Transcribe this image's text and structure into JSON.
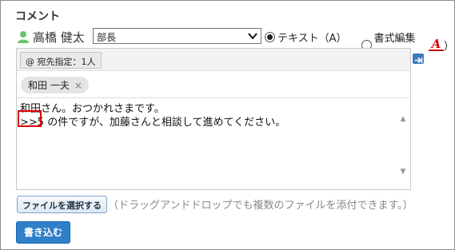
{
  "section": {
    "title": "コメント"
  },
  "poster": {
    "name": "高橋 健太",
    "icon": "user-icon"
  },
  "role_select": {
    "value": "部長"
  },
  "format": {
    "text_label": "テキスト（A）",
    "rich_label": "書式編集（",
    "rich_suffix": "）",
    "selected": "text"
  },
  "recipients": {
    "button_label": "@ 宛先指定：1人",
    "chips": [
      {
        "name": "和田 一夫",
        "remove": "×"
      }
    ]
  },
  "message": {
    "lines": [
      "和田さん。おつかれさまです。",
      ">>5 の件ですが、加藤さんと相談して進めてください。"
    ]
  },
  "attachments": {
    "button_label": "ファイルを選択する",
    "hint": "（ドラッグアンドドロップでも複数のファイルを添付できます。）"
  },
  "actions": {
    "submit_label": "書き込む"
  },
  "colors": {
    "accent": "#2f7fc9",
    "highlight": "#e00000",
    "format_icon": "#d00000",
    "user_icon": "#6cc36c"
  }
}
